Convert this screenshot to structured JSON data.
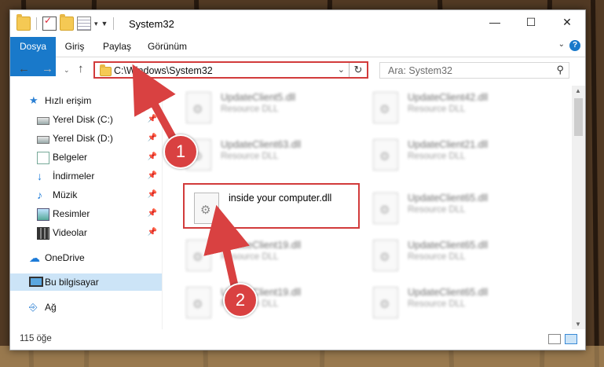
{
  "window": {
    "title": "System32",
    "controls": [
      "minimize-icon",
      "maximize-icon",
      "close-icon"
    ]
  },
  "ribbon": {
    "tabs": [
      "Dosya",
      "Giriş",
      "Paylaş",
      "Görünüm"
    ],
    "help": "?"
  },
  "address": {
    "path": "C:\\Windows\\System32",
    "search_placeholder": "Ara: System32"
  },
  "nav_pane": {
    "items": [
      {
        "label": "Hızlı erişim",
        "icon": "star-icon"
      },
      {
        "label": "Yerel Disk (C:)",
        "icon": "drive-icon",
        "pinned": true
      },
      {
        "label": "Yerel Disk (D:)",
        "icon": "drive-icon",
        "pinned": true
      },
      {
        "label": "Belgeler",
        "icon": "documents-icon",
        "pinned": true
      },
      {
        "label": "İndirmeler",
        "icon": "download-icon",
        "pinned": true
      },
      {
        "label": "Müzik",
        "icon": "music-icon",
        "pinned": true
      },
      {
        "label": "Resimler",
        "icon": "pictures-icon",
        "pinned": true
      },
      {
        "label": "Videolar",
        "icon": "videos-icon",
        "pinned": true
      },
      {
        "label": "OneDrive",
        "icon": "cloud-icon"
      },
      {
        "label": "Bu bilgisayar",
        "icon": "computer-icon",
        "selected": true
      },
      {
        "label": "Ağ",
        "icon": "network-icon"
      }
    ]
  },
  "files": [
    {
      "name": "UpdateClient5.dll",
      "type": "Resource DLL"
    },
    {
      "name": "UpdateClient42.dll",
      "type": "Resource DLL"
    },
    {
      "name": "UpdateClient63.dll",
      "type": "Resource DLL"
    },
    {
      "name": "UpdateClient21.dll",
      "type": "Resource DLL"
    },
    {
      "name": "inside your computer.dll",
      "type": ""
    },
    {
      "name": "UpdateClient65.dll",
      "type": "Resource DLL"
    },
    {
      "name": "UpdateClient19.dll",
      "type": "Resource DLL"
    },
    {
      "name": "UpdateClient65.dll",
      "type": "Resource DLL"
    },
    {
      "name": "UpdateClient19.dll",
      "type": "Resource DLL"
    },
    {
      "name": "UpdateClient65.dll",
      "type": "Resource DLL"
    }
  ],
  "status": {
    "count": "115 öğe"
  },
  "annotations": {
    "step1": "1",
    "step2": "2",
    "color": "#d94141"
  }
}
